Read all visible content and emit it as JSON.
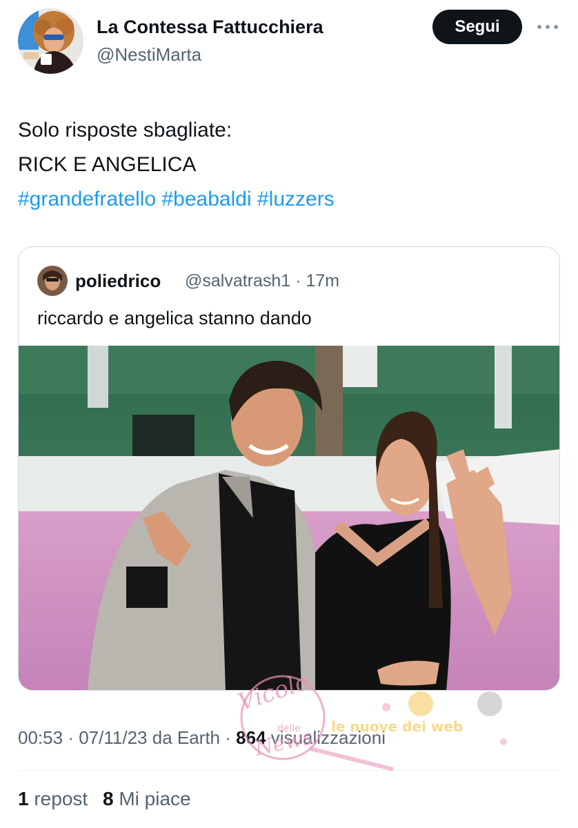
{
  "author": {
    "display_name": "La Contessa Fattucchiera",
    "handle": "@NestiMarta",
    "avatar_icon": "profile-avatar"
  },
  "follow_label": "Segui",
  "more_icon": "ellipsis-icon",
  "tweet": {
    "line1": "Solo risposte sbagliate:",
    "line2": "RICK E ANGELICA",
    "hashtags": [
      "#grandefratello",
      "#beabaldi",
      "#luzzers"
    ]
  },
  "quoted": {
    "name": "poliedrico",
    "handle": "@salvatrash1",
    "separator": "·",
    "time": "17m",
    "text": "riccardo e angelica stanno dando",
    "photo_icon": "photo-couple-red-carpet"
  },
  "meta": {
    "time": "00:53",
    "sep1": "·",
    "date": "07/11/23",
    "source": "da Earth",
    "sep2": "·",
    "views_count": "864",
    "views_label": "visualizzazioni"
  },
  "stats": {
    "reposts_count": "1",
    "reposts_label": "repost",
    "likes_count": "8",
    "likes_label": "Mi piace"
  },
  "watermark": {
    "text1": "Vicolo",
    "text2": "delle",
    "text3": "News",
    "text4": "le nuove dei web"
  },
  "colors": {
    "link": "#1d9bf0",
    "secondary_text": "#536471",
    "primary_text": "#0f1419",
    "follow_bg": "#0f1419",
    "watermark_pink": "#e88fb3"
  }
}
